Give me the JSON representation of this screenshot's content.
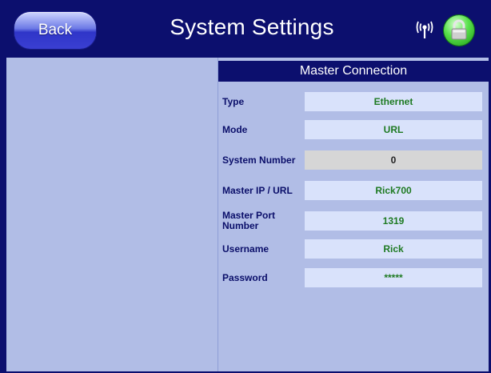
{
  "header": {
    "back_label": "Back",
    "title": "System Settings"
  },
  "icons": {
    "signal": "wireless-signal-icon",
    "lock": "lock-icon"
  },
  "colors": {
    "header_bg": "#0c0f6e",
    "panel_bg": "#b1bde6",
    "value_bg": "#d9e2fb",
    "value_text": "#1e7a22",
    "label_text": "#0b0f6a",
    "lock_green": "#58e04a"
  },
  "master_connection": {
    "title": "Master Connection",
    "fields": [
      {
        "label": "Type",
        "value": "Ethernet"
      },
      {
        "label": "Mode",
        "value": "URL"
      },
      {
        "label": "System Number",
        "value": "0"
      },
      {
        "label": "Master IP / URL",
        "value": "Rick700"
      },
      {
        "label": "Master Port Number",
        "value": "1319"
      },
      {
        "label": "Username",
        "value": "Rick"
      },
      {
        "label": "Password",
        "value": "*****"
      }
    ]
  }
}
